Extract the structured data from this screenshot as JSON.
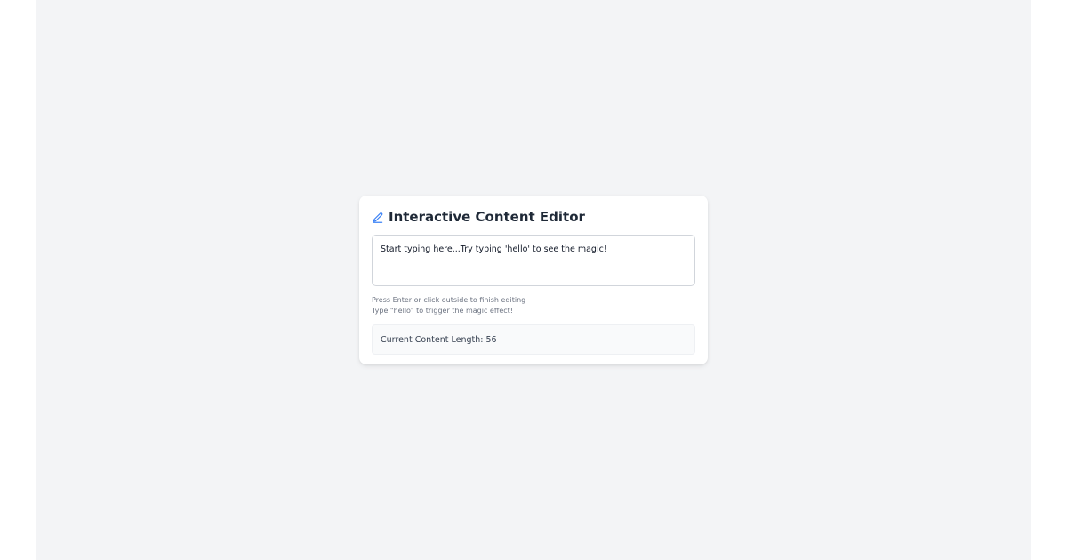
{
  "editor": {
    "title": "Interactive Content Editor",
    "content": "Start typing here...Try typing 'hello' to see the magic!",
    "hint_1": "Press Enter or click outside to finish editing",
    "hint_2": "Type \"hello\" to trigger the magic effect!",
    "stats_label": "Current Content Length:",
    "content_length": "56"
  },
  "icons": {
    "title_icon": "pencil-icon"
  },
  "colors": {
    "accent": "#3b82f6",
    "background": "#f3f4f6",
    "card": "#ffffff",
    "title_text": "#1f2937",
    "hint_text": "#6b7280"
  }
}
